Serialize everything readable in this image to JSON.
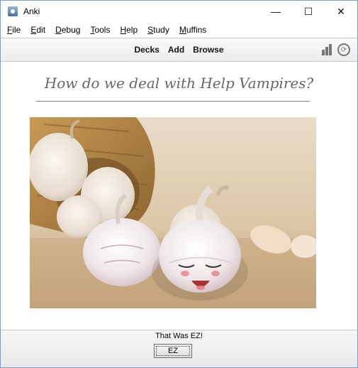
{
  "window": {
    "title": "Anki",
    "minimize_label": "—",
    "maximize_label": "☐",
    "close_label": "✕"
  },
  "menubar": {
    "items": [
      {
        "u": "F",
        "rest": "ile"
      },
      {
        "u": "E",
        "rest": "dit"
      },
      {
        "u": "D",
        "rest": "ebug"
      },
      {
        "u": "T",
        "rest": "ools"
      },
      {
        "u": "H",
        "rest": "elp"
      },
      {
        "u": "S",
        "rest": "tudy"
      },
      {
        "u": "M",
        "rest": "uffins"
      }
    ]
  },
  "toolbar": {
    "decks": "Decks",
    "add": "Add",
    "browse": "Browse",
    "sync_glyph": "⟳"
  },
  "card": {
    "question": "How do we deal with Help Vampires?",
    "image_alt": "kawaii garlic bulb with a smiling face"
  },
  "footer": {
    "answer_label": "That Was EZ!",
    "button_label": "EZ"
  },
  "colors": {
    "border": "#7a9cc8",
    "question": "#666666"
  }
}
